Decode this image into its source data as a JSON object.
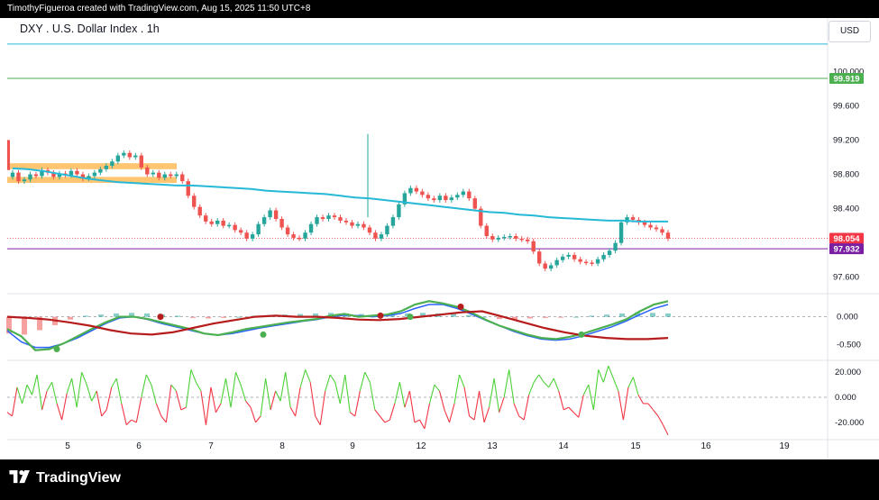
{
  "header": {
    "attribution": "TimothyFigueroa created with TradingView.com, Aug 15, 2025 11:50 UTC+8"
  },
  "symbol": {
    "title": "DXY . U.S. Dollar Index . 1h",
    "currency": "USD"
  },
  "brand": {
    "name": "TradingView",
    "logo_icon": "tradingview-logo-icon"
  },
  "colors": {
    "up_candle": "#26a69a",
    "down_candle": "#ef5350",
    "moving_average": "#26b9d7",
    "last_price_label": "#f23645",
    "purple_line": "#7b1fa2",
    "green_level": "#4caf50",
    "macd_signal_up": "#4caf50",
    "macd_signal_down": "#b71c1c",
    "macd_blue": "#2962ff",
    "zone": "#ffb74d"
  },
  "chart_data": [
    {
      "type": "candlestick",
      "series_name": "DXY",
      "x_tick_labels": [
        "5",
        "6",
        "7",
        "8",
        "9",
        "12",
        "13",
        "14",
        "15",
        "16",
        "19"
      ],
      "y_tick_labels": [
        "100.000",
        "99.600",
        "99.200",
        "98.800",
        "98.400",
        "97.600"
      ],
      "ylim": [
        97.45,
        100.35
      ],
      "price_labels": [
        {
          "text": "99.919",
          "value": 99.919,
          "color": "#4caf50"
        },
        {
          "text": "98.054",
          "value": 98.054,
          "color": "#f23645"
        },
        {
          "text": "97.932",
          "value": 97.932,
          "color": "#7b1fa2"
        }
      ],
      "horizontal_lines": [
        {
          "value": 99.919,
          "color": "#4caf50"
        },
        {
          "value": 97.932,
          "color": "#7b1fa2"
        },
        {
          "value": 100.32,
          "color": "#26b9d7"
        }
      ],
      "zones": [
        {
          "from_day": 4.2,
          "to_day": 6.35,
          "low": 98.86,
          "high": 98.93
        },
        {
          "from_day": 4.2,
          "to_day": 6.35,
          "low": 98.7,
          "high": 98.77
        }
      ],
      "close": [
        98.82,
        98.72,
        98.74,
        98.8,
        98.78,
        98.85,
        98.82,
        98.77,
        98.81,
        98.79,
        98.84,
        98.8,
        98.75,
        98.78,
        98.82,
        98.86,
        98.9,
        98.95,
        99.02,
        99.05,
        99.0,
        99.02,
        98.88,
        98.8,
        98.82,
        98.76,
        98.8,
        98.78,
        98.8,
        98.72,
        98.55,
        98.42,
        98.32,
        98.25,
        98.22,
        98.26,
        98.2,
        98.21,
        98.15,
        98.12,
        98.05,
        98.1,
        98.22,
        98.3,
        98.38,
        98.28,
        98.18,
        98.1,
        98.06,
        98.05,
        98.12,
        98.22,
        98.3,
        98.28,
        98.32,
        98.3,
        98.26,
        98.24,
        98.2,
        98.22,
        98.18,
        98.12,
        98.05,
        98.1,
        98.2,
        98.3,
        98.45,
        98.58,
        98.64,
        98.6,
        98.56,
        98.52,
        98.5,
        98.55,
        98.5,
        98.53,
        98.56,
        98.6,
        98.52,
        98.4,
        98.2,
        98.08,
        98.04,
        98.06,
        98.07,
        98.08,
        98.05,
        98.04,
        98.02,
        97.9,
        97.76,
        97.7,
        97.74,
        97.8,
        97.84,
        97.86,
        97.81,
        97.78,
        97.77,
        97.76,
        97.81,
        97.86,
        97.91,
        98.0,
        98.24,
        98.3,
        98.27,
        98.24,
        98.21,
        98.18,
        98.16,
        98.12,
        98.05
      ],
      "moving_average": [
        98.87,
        98.86,
        98.84,
        98.81,
        98.78,
        98.75,
        98.73,
        98.71,
        98.7,
        98.69,
        98.68,
        98.67,
        98.67,
        98.66,
        98.65,
        98.64,
        98.63,
        98.61,
        98.6,
        98.59,
        98.58,
        98.57,
        98.55,
        98.53,
        98.52,
        98.5,
        98.48,
        98.46,
        98.44,
        98.42,
        98.4,
        98.38,
        98.36,
        98.35,
        98.33,
        98.32,
        98.3,
        98.29,
        98.28,
        98.27,
        98.26,
        98.26,
        98.25,
        98.25,
        98.25
      ],
      "macd_histogram": [
        -0.3,
        -0.32,
        -0.24,
        -0.15,
        -0.05,
        0.02,
        0.04,
        0.06,
        0.07,
        0.06,
        0.04,
        0.02,
        -0.02,
        -0.03,
        -0.02,
        0.0,
        0.02,
        0.03,
        0.04,
        0.05,
        0.06,
        0.07,
        0.06,
        0.05,
        0.04,
        0.05,
        0.06,
        0.07,
        0.06,
        0.05,
        0.03,
        0.0,
        -0.04,
        -0.06,
        -0.03,
        -0.02,
        -0.01,
        0.0,
        0.02,
        0.04,
        0.06,
        0.08,
        0.07,
        0.06
      ],
      "macd_green": [
        -0.22,
        -0.35,
        -0.6,
        -0.58,
        -0.48,
        -0.35,
        -0.22,
        -0.1,
        0.0,
        0.0,
        -0.04,
        -0.1,
        -0.16,
        -0.22,
        -0.3,
        -0.33,
        -0.28,
        -0.22,
        -0.18,
        -0.14,
        -0.1,
        -0.07,
        -0.04,
        0.02,
        0.05,
        0.0,
        0.02,
        0.04,
        0.1,
        0.22,
        0.28,
        0.24,
        0.18,
        0.08,
        -0.05,
        -0.16,
        -0.24,
        -0.32,
        -0.38,
        -0.4,
        -0.36,
        -0.3,
        -0.22,
        -0.14,
        -0.05,
        0.1,
        0.22,
        0.28
      ],
      "macd_blue": [
        -0.25,
        -0.45,
        -0.55,
        -0.55,
        -0.48,
        -0.38,
        -0.25,
        -0.12,
        -0.02,
        0.0,
        -0.05,
        -0.12,
        -0.18,
        -0.24,
        -0.3,
        -0.33,
        -0.3,
        -0.25,
        -0.2,
        -0.16,
        -0.12,
        -0.08,
        -0.05,
        0.0,
        0.03,
        0.02,
        0.0,
        0.02,
        0.06,
        0.15,
        0.22,
        0.22,
        0.15,
        0.05,
        -0.06,
        -0.16,
        -0.26,
        -0.34,
        -0.4,
        -0.42,
        -0.4,
        -0.34,
        -0.26,
        -0.18,
        -0.08,
        0.04,
        0.15,
        0.22
      ],
      "macd_red": [
        0.0,
        -0.02,
        -0.05,
        -0.1,
        -0.16,
        -0.24,
        -0.3,
        -0.32,
        -0.28,
        -0.2,
        -0.12,
        -0.06,
        0.0,
        0.02,
        0.0,
        0.0,
        -0.02,
        -0.05,
        -0.06,
        -0.04,
        0.0,
        0.04,
        0.08,
        0.1,
        0.0,
        -0.1,
        -0.2,
        -0.28,
        -0.34,
        -0.38,
        -0.4,
        -0.4,
        -0.38
      ],
      "macd_ylim": [
        -0.75,
        0.35
      ],
      "macd_tick_labels": [
        "0.000",
        "-0.500"
      ],
      "oscillator": [
        -12,
        -15,
        8,
        -5,
        10,
        2,
        18,
        -10,
        5,
        12,
        -5,
        -18,
        3,
        15,
        -8,
        20,
        10,
        -3,
        5,
        -15,
        -10,
        8,
        15,
        -5,
        -22,
        -18,
        -20,
        0,
        18,
        10,
        -5,
        -15,
        -20,
        10,
        5,
        -10,
        -8,
        22,
        12,
        5,
        -22,
        8,
        -12,
        -5,
        15,
        -8,
        20,
        10,
        -3,
        -8,
        -20,
        -15,
        15,
        -10,
        5,
        -3,
        20,
        -8,
        -15,
        8,
        22,
        12,
        -15,
        -22,
        5,
        18,
        12,
        -5,
        18,
        -12,
        -15,
        5,
        20,
        12,
        -10,
        -15,
        -20,
        -18,
        -5,
        12,
        -8,
        5,
        -20,
        -18,
        -25,
        -5,
        10,
        5,
        -10,
        -20,
        -5,
        18,
        8,
        -15,
        -18,
        5,
        -20,
        -8,
        15,
        -12,
        0,
        22,
        -5,
        -15,
        -18,
        2,
        12,
        18,
        12,
        8,
        15,
        5,
        -10,
        -8,
        -12,
        -16,
        2,
        10,
        -10,
        22,
        12,
        25,
        15,
        5,
        -18,
        8,
        16,
        2,
        -5,
        -5,
        -10,
        -15,
        -22,
        -30
      ],
      "oscillator_ylim": [
        -28,
        28
      ],
      "oscillator_tick_labels": [
        "20.000",
        "0.000",
        "-20.000"
      ]
    }
  ]
}
